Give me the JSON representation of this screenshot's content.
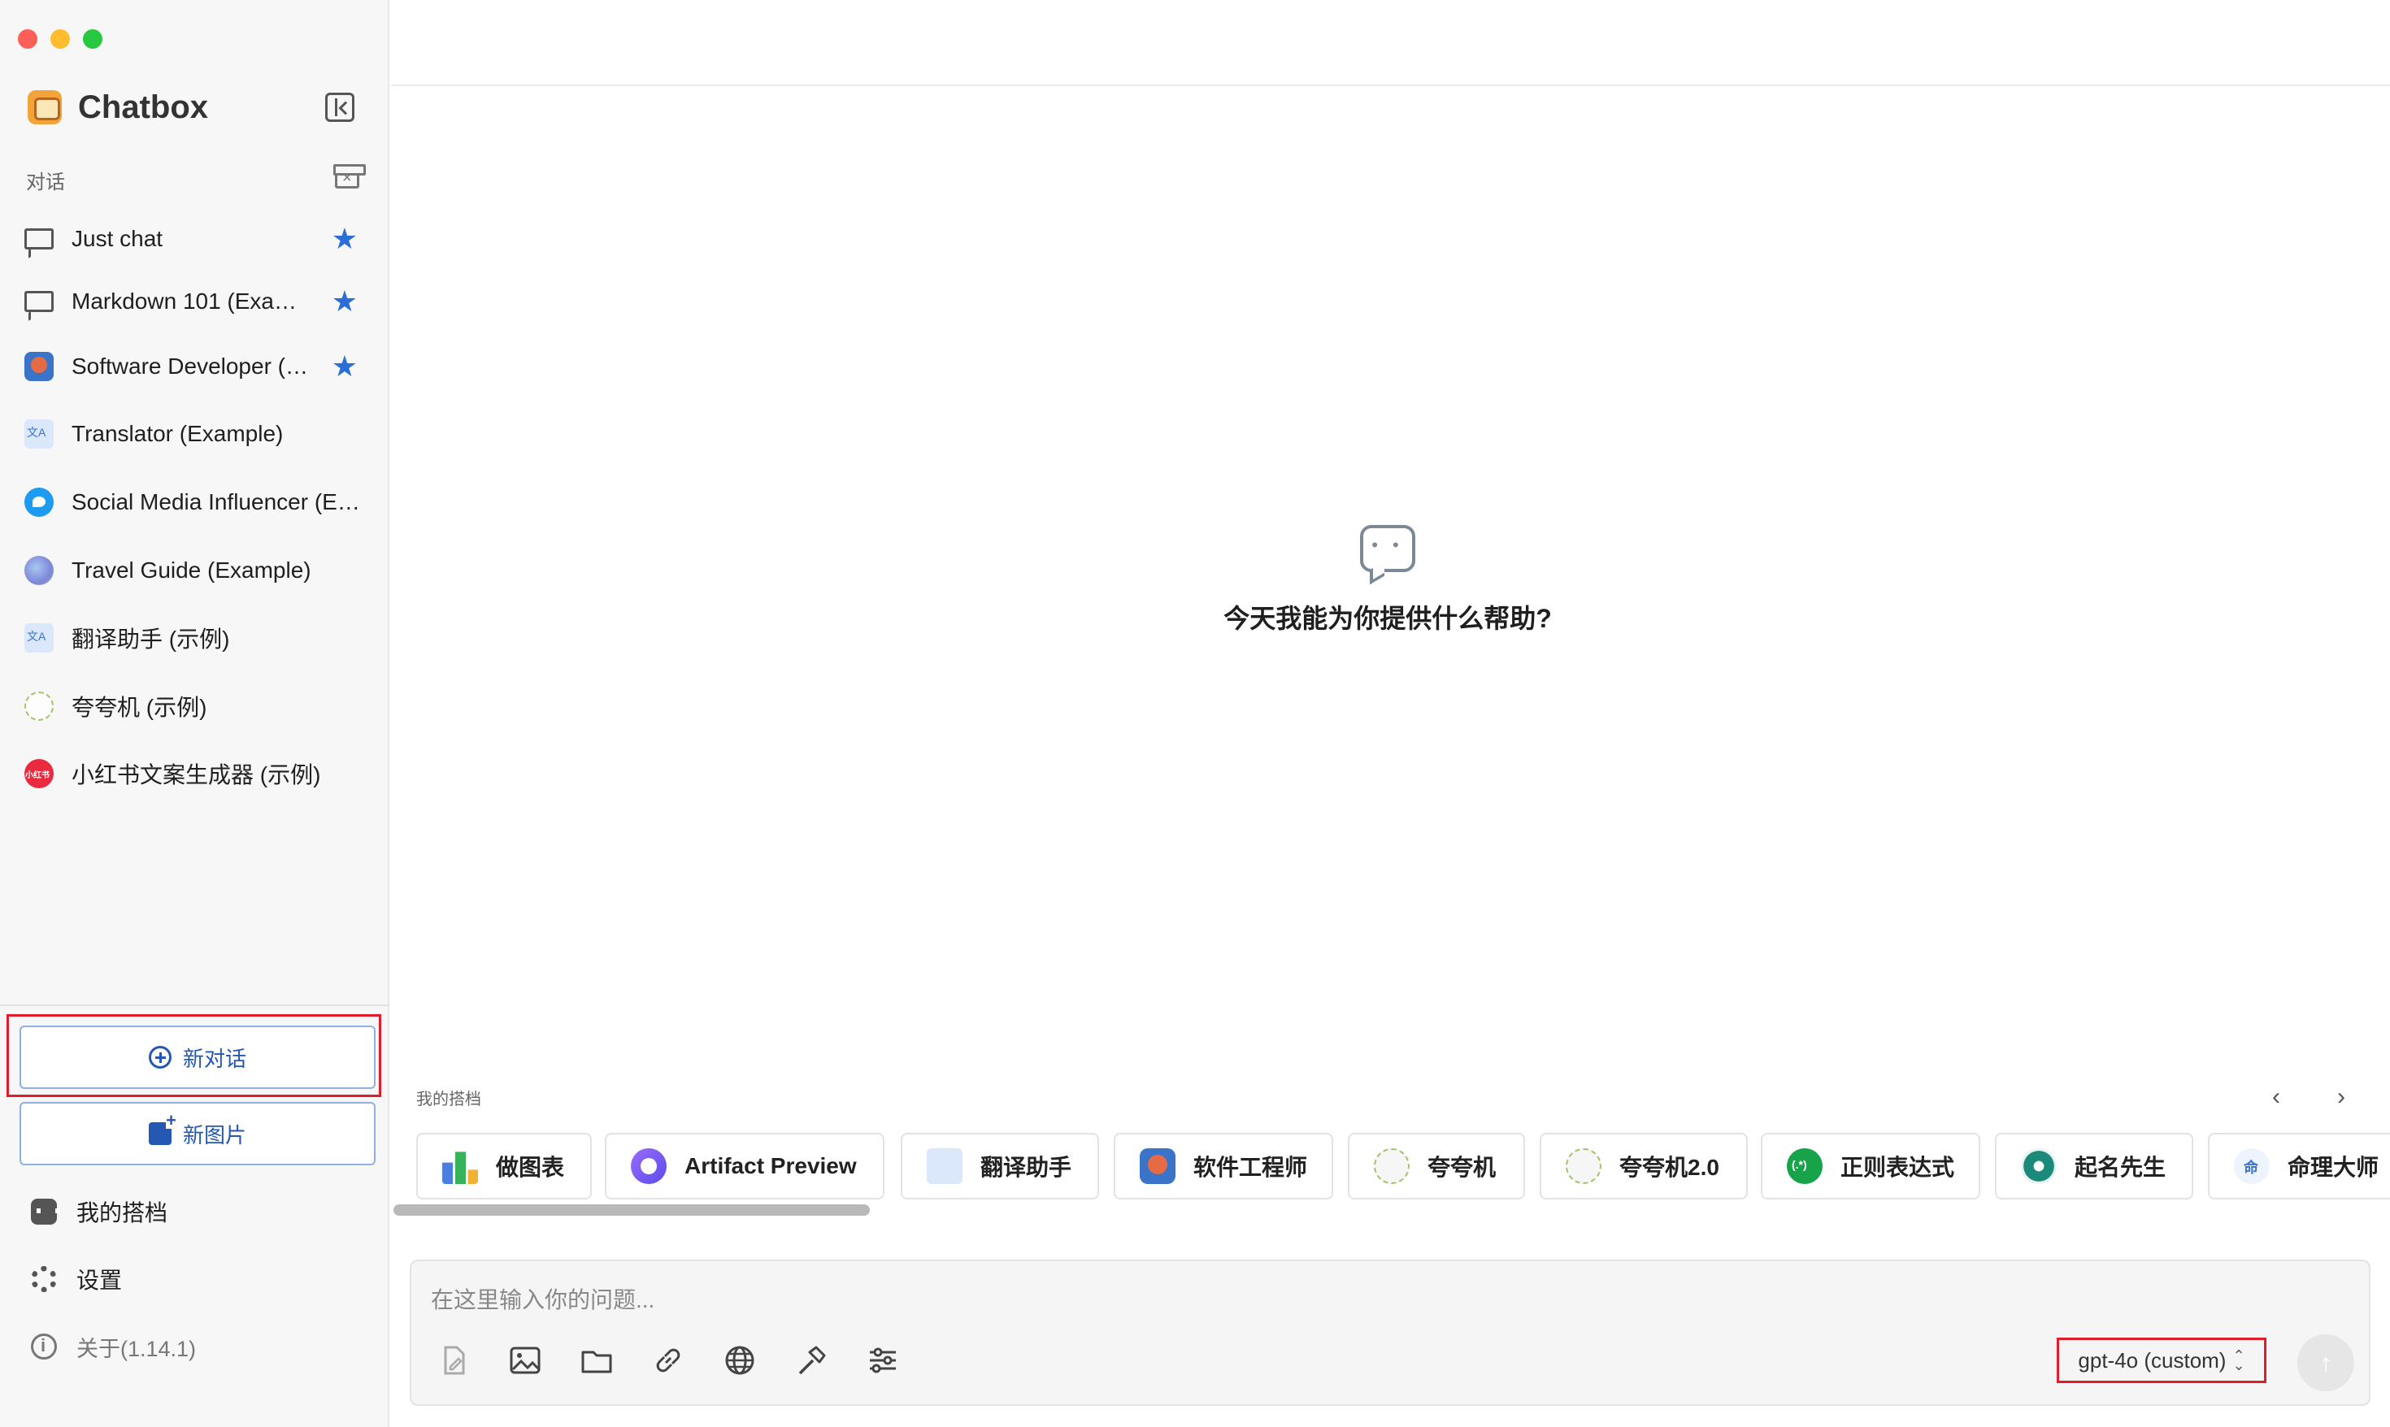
{
  "sidebar": {
    "brand": "Chatbox",
    "section_label": "对话",
    "conversations": [
      {
        "label": "Just chat",
        "icon": "chat-bubble-icon",
        "starred": true
      },
      {
        "label": "Markdown 101 (Example)",
        "icon": "chat-bubble-icon",
        "starred": true
      },
      {
        "label": "Software Developer (Example)",
        "icon": "developer-avatar-icon",
        "starred": true
      },
      {
        "label": "Translator (Example)",
        "icon": "translator-avatar-icon",
        "starred": false
      },
      {
        "label": "Social Media Influencer (Example)",
        "icon": "twitter-avatar-icon",
        "starred": false
      },
      {
        "label": "Travel Guide (Example)",
        "icon": "globe-avatar-icon",
        "starred": false
      },
      {
        "label": "翻译助手 (示例)",
        "icon": "translator-avatar-icon",
        "starred": false
      },
      {
        "label": "夸夸机 (示例)",
        "icon": "kuakua-avatar-icon",
        "starred": false
      },
      {
        "label": "小红书文案生成器 (示例)",
        "icon": "xiaohongshu-avatar-icon",
        "starred": false
      }
    ],
    "new_chat_label": "新对话",
    "new_image_label": "新图片",
    "menu": {
      "copilots": "我的搭档",
      "settings": "设置",
      "about": "关于(1.14.1)"
    }
  },
  "main": {
    "empty_title": "今天我能为你提供什么帮助?",
    "copilots_label": "我的搭档",
    "copilots": [
      {
        "label": "做图表",
        "icon": "bar-chart-icon"
      },
      {
        "label": "Artifact Preview",
        "icon": "artifact-icon"
      },
      {
        "label": "翻译助手",
        "icon": "translator-icon"
      },
      {
        "label": "软件工程师",
        "icon": "developer-icon"
      },
      {
        "label": "夸夸机",
        "icon": "kuakua-icon"
      },
      {
        "label": "夸夸机2.0",
        "icon": "kuakua-icon"
      },
      {
        "label": "正则表达式",
        "icon": "regex-icon"
      },
      {
        "label": "起名先生",
        "icon": "naming-icon"
      },
      {
        "label": "命理大师",
        "icon": "fortune-icon"
      }
    ],
    "input": {
      "placeholder": "在这里输入你的问题...",
      "value": ""
    },
    "model": "gpt-4o (custom)"
  },
  "colors": {
    "accent": "#2458b3",
    "star": "#2b6fd6",
    "highlight": "#e11d2b"
  }
}
